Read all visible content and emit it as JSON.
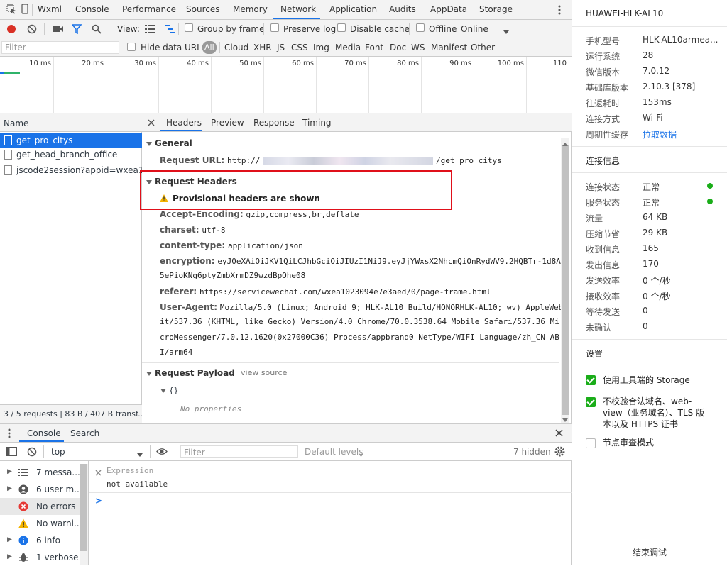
{
  "top_tabs": [
    "Wxml",
    "Console",
    "Performance",
    "Sources",
    "Memory",
    "Network",
    "Application",
    "Audits",
    "AppData",
    "Storage"
  ],
  "toolbar": {
    "view_label": "View:",
    "group_by_frame": "Group by frame",
    "preserve_log": "Preserve log",
    "disable_cache": "Disable cache",
    "offline": "Offline",
    "online": "Online"
  },
  "filter_bar": {
    "filter_placeholder": "Filter",
    "hide_data_urls": "Hide data URLs",
    "types": [
      "All",
      "Cloud",
      "XHR",
      "JS",
      "CSS",
      "Img",
      "Media",
      "Font",
      "Doc",
      "WS",
      "Manifest",
      "Other"
    ]
  },
  "timeline_ticks": [
    "10 ms",
    "20 ms",
    "30 ms",
    "40 ms",
    "50 ms",
    "60 ms",
    "70 ms",
    "80 ms",
    "90 ms",
    "100 ms",
    "110"
  ],
  "request_list": {
    "header": "Name",
    "items": [
      "get_pro_citys",
      "get_head_branch_office",
      "jscode2session?appid=wxea10..."
    ],
    "status": "3 / 5 requests  |  83 B / 407 B transf..."
  },
  "detail_tabs": [
    "Headers",
    "Preview",
    "Response",
    "Timing"
  ],
  "general": {
    "title": "General",
    "request_url_key": "Request URL:",
    "request_url_prefix": "http://",
    "request_url_suffix": "/get_pro_citys"
  },
  "request_headers": {
    "title": "Request Headers",
    "warning": "Provisional headers are shown",
    "accept_encoding_key": "Accept-Encoding:",
    "accept_encoding_val": "gzip,compress,br,deflate",
    "charset_key": "charset:",
    "charset_val": "utf-8",
    "content_type_key": "content-type:",
    "content_type_val": "application/json",
    "encryption_key": "encryption:",
    "encryption_val_1": "eyJ0eXAiOiJKV1QiLCJhbGciOiJIUzI1NiJ9.eyJjYWxsX2NhcmQiOnRydWV9.2HQBTr-1d8A9",
    "encryption_val_2": "5ePioKNg6ptyZmbXrmDZ9wzdBpOhe08",
    "referer_key": "referer:",
    "referer_val": "https://servicewechat.com/wxea1023094e7e3aed/0/page-frame.html",
    "ua_key": "User-Agent:",
    "ua_val_1": "Mozilla/5.0 (Linux; Android 9; HLK-AL10 Build/HONORHLK-AL10; wv) AppleWebK",
    "ua_val_2": "it/537.36 (KHTML, like Gecko) Version/4.0 Chrome/70.0.3538.64 Mobile Safari/537.36 Mi",
    "ua_val_3": "croMessenger/7.0.12.1620(0x27000C36) Process/appbrand0 NetType/WIFI Language/zh_CN AB",
    "ua_val_4": "I/arm64"
  },
  "request_payload": {
    "title": "Request Payload",
    "view_source": "view source",
    "obj": "{}",
    "no_props": "No properties"
  },
  "drawer": {
    "tabs": [
      "Console",
      "Search"
    ],
    "context": "top",
    "filter_placeholder": "Filter",
    "levels": "Default levels",
    "hidden": "7 hidden",
    "sidebar": [
      "7 messa...",
      "6 user m...",
      "No errors",
      "No warni...",
      "6 info",
      "1 verbose"
    ],
    "expression_label": "Expression",
    "expression_value": "not available",
    "prompt": ">"
  },
  "right_panel": {
    "device": "HUAWEI-HLK-AL10",
    "info_rows": [
      {
        "k": "手机型号",
        "v": "HLK-AL10armea..."
      },
      {
        "k": "运行系统",
        "v": "28"
      },
      {
        "k": "微信版本",
        "v": "7.0.12"
      },
      {
        "k": "基础库版本",
        "v": "2.10.3 [378]"
      },
      {
        "k": "往返耗时",
        "v": "153ms"
      },
      {
        "k": "连接方式",
        "v": "Wi-Fi"
      },
      {
        "k": "周期性缓存",
        "v": "拉取数据"
      }
    ],
    "conn_title": "连接信息",
    "conn_rows": [
      {
        "k": "连接状态",
        "v": "正常"
      },
      {
        "k": "服务状态",
        "v": "正常"
      },
      {
        "k": "流量",
        "v": "64 KB"
      },
      {
        "k": "压缩节省",
        "v": "29 KB"
      },
      {
        "k": "收到信息",
        "v": "165"
      },
      {
        "k": "发出信息",
        "v": "170"
      },
      {
        "k": "发送效率",
        "v": "0 个/秒"
      },
      {
        "k": "接收效率",
        "v": "0 个/秒"
      },
      {
        "k": "等待发送",
        "v": "0"
      },
      {
        "k": "未确认",
        "v": "0"
      }
    ],
    "settings_title": "设置",
    "setting_1": "使用工具端的 Storage",
    "setting_2a": "不校验合法域名、web-",
    "setting_2b": "view（业务域名）、TLS 版",
    "setting_2c": "本以及 HTTPS 证书",
    "setting_3": "节点审查模式",
    "end_debug": "结束调试"
  },
  "colors": {
    "accent": "#1a73e8",
    "highlight_box": "#e0101a",
    "ok_green": "#1aad19",
    "record_red": "#d93025"
  }
}
